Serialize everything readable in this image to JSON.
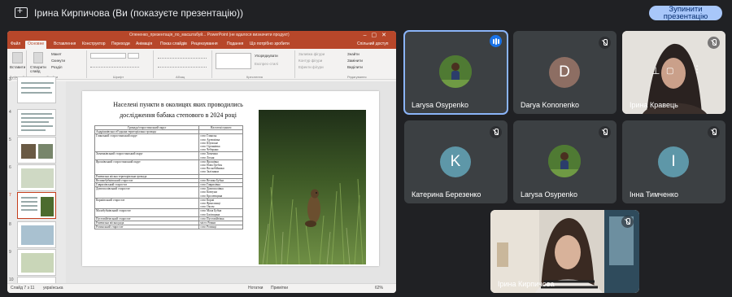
{
  "meeting": {
    "presenter_banner": "Ірина Кирпичова (Ви (показуєте презентацію))",
    "stop_button_line1": "Зупинити",
    "stop_button_line2": "презентацію"
  },
  "powerpoint": {
    "doc_title": "Олененко_презентація_по_масштабуй... PowerPoint (не вдалося визначити продукт)",
    "tabs": [
      "Файл",
      "Основне",
      "Вставлення",
      "Конструктор",
      "Переходи",
      "Анімація",
      "Показ слайдів",
      "Рецензування",
      "Подання",
      "Що потрібно зробити"
    ],
    "active_tab": "Основне",
    "share_label": "Спільний доступ",
    "ribbon": {
      "paste": "Вставити",
      "create_slide": "Створити слайд",
      "layout": "Макет",
      "reset": "Скинути",
      "section": "Розділ",
      "groups": [
        "Буфер обміну",
        "Слайди",
        "Шрифт",
        "Абзац",
        "Креслення",
        "Редагування"
      ],
      "arrange": "Упорядкувати",
      "quick_styles": "Експрес-стилі",
      "shape_fill": "Заливка фігури",
      "shape_outline": "Контур фігури",
      "shape_effects": "Ефекти фігури",
      "find": "Знайти",
      "replace": "Замінити",
      "select": "Виділити"
    },
    "thumbnails": [
      "3",
      "4",
      "5",
      "6",
      "7",
      "8",
      "9",
      "10"
    ],
    "selected_thumbnail": "7",
    "slide": {
      "title": "Населені пункти в околицях яких проводились дослідження бабака степового в 2024 році",
      "table_headers": [
        "Громада/старостинський округ",
        "Населені пункти"
      ],
      "table_rows": [
        [
          "Андріяшівська об'єднана територіальна громада",
          ""
        ],
        [
          "Глинський старостинський округ",
          "село Глинськ\nсело Артюхівка\nсело Шумське\nсело Сірчанівка\nсело Чеберяки"
        ],
        [
          "Хоменківський старостинський округ",
          "село Хоменки\nсело Лохня"
        ],
        [
          "Ярошівський старостинський округ",
          "село Ярошівка\nсело Нова Гребля\nсело Воскобійники\nсело Залізняки"
        ],
        [
          "Роменська міська територіальна громада",
          ""
        ],
        [
          "Великобубнівський старостат",
          "село Велика Бубна"
        ],
        [
          "Гаврилівський старостат",
          "село Гаврилівка"
        ],
        [
          "Довгополівський старостат",
          "село Довгополівка\nсело Ковтуни\nсело Кролевщина"
        ],
        [
          "Коржівський старостат",
          "село Коржі\nсело Ярмолинці\nсело Оксен"
        ],
        [
          "Малобубнівський старостат",
          "село Мала Бубна\nсело Басівщина"
        ],
        [
          "Пустовійтівський старостат",
          "село Пустовійтівка"
        ],
        [
          "Роменська міська рада",
          "місто Ромни"
        ],
        [
          "Рогинський старостат",
          "село Рогинці"
        ]
      ]
    },
    "status": {
      "slide_of": "Слайд 7 з 11",
      "lang": "українська",
      "notes": "Нотатки",
      "comments": "Примітки",
      "zoom": "62%"
    }
  },
  "participants": [
    {
      "name": "Larysa Osypenko",
      "type": "photo",
      "state": "speaking",
      "active": true
    },
    {
      "name": "Darya Kononenko",
      "type": "letter",
      "letter": "D",
      "color": "#8d6e63",
      "state": "muted"
    },
    {
      "name": "Ірина Кравець",
      "type": "video",
      "state": "muted"
    },
    {
      "name": "Катерина Березенко",
      "type": "letter",
      "letter": "K",
      "color": "#5e97a8",
      "state": "muted"
    },
    {
      "name": "Larysa Osypenko",
      "type": "photo",
      "state": "muted"
    },
    {
      "name": "Інна Тимченко",
      "type": "letter",
      "letter": "I",
      "color": "#5e97a8",
      "state": "muted"
    },
    {
      "name": "Ірина Кирпичова",
      "type": "video",
      "state": "muted"
    }
  ]
}
